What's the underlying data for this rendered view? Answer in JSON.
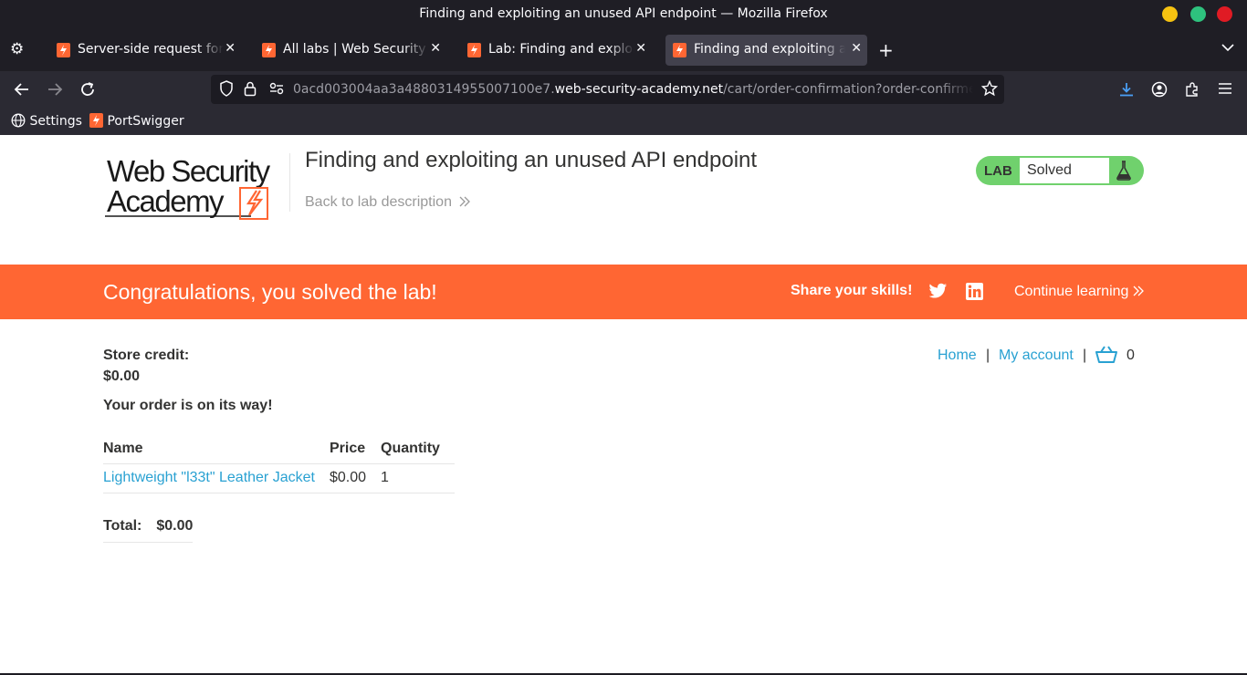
{
  "window": {
    "title": "Finding and exploiting an unused API endpoint — Mozilla Firefox"
  },
  "tabs": [
    {
      "label": "Server-side request forgery",
      "active": false
    },
    {
      "label": "All labs | Web Security Academy",
      "active": false
    },
    {
      "label": "Lab: Finding and exploiting an unused API endpoint",
      "active": false
    },
    {
      "label": "Finding and exploiting an unused API endpoint",
      "active": true
    }
  ],
  "urlbar": {
    "prefix": "0acd003004aa3a4880314955007100e7.",
    "domain": "web-security-academy.net",
    "path": "/cart/order-confirmation?order-confirmed=true"
  },
  "bookmarks": [
    {
      "label": "Settings",
      "icon": "globe-icon"
    },
    {
      "label": "PortSwigger",
      "icon": "portswigger-icon"
    }
  ],
  "header": {
    "logo_line1": "Web Security",
    "logo_line2": "Academy",
    "lab_title": "Finding and exploiting an unused API endpoint",
    "back_link": "Back to lab description",
    "lab_tag": "LAB",
    "lab_status": "Solved"
  },
  "banner": {
    "congrats": "Congratulations, you solved the lab!",
    "share": "Share your skills!",
    "continue": "Continue learning"
  },
  "store": {
    "credit_label": "Store credit:",
    "credit_value": "$0.00",
    "order_message": "Your order is on its way!"
  },
  "nav": {
    "home": "Home",
    "sep": "|",
    "account": "My account",
    "cart_count": "0"
  },
  "order": {
    "headers": {
      "name": "Name",
      "price": "Price",
      "quantity": "Quantity"
    },
    "rows": [
      {
        "name": "Lightweight \"l33t\" Leather Jacket",
        "price": "$0.00",
        "quantity": "1"
      }
    ],
    "total_label": "Total:",
    "total_value": "$0.00"
  },
  "colors": {
    "accent_orange": "#ff6633",
    "link_blue": "#29a1d2",
    "solved_green": "#70d16d"
  }
}
